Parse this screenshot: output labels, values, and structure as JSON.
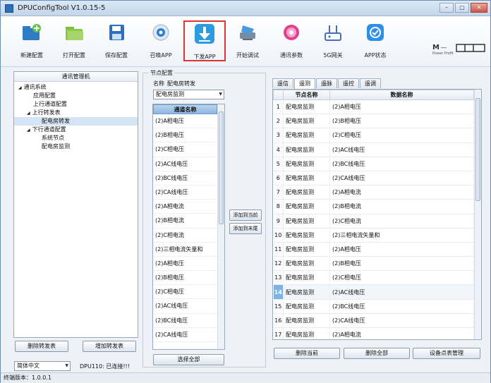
{
  "window": {
    "title": "DPUConfigTool V1.0.15-5",
    "min": "–",
    "max": "▢",
    "close": "✕"
  },
  "toolbar": [
    {
      "label": "新建配置",
      "icon": "new-config-icon"
    },
    {
      "label": "打开配置",
      "icon": "open-folder-icon"
    },
    {
      "label": "保存配置",
      "icon": "save-disk-icon"
    },
    {
      "label": "召唤APP",
      "icon": "summon-app-icon"
    },
    {
      "label": "下发APP",
      "icon": "download-arrow-icon",
      "selected": true
    },
    {
      "label": "开始调试",
      "icon": "debug-icon"
    },
    {
      "label": "通讯参数",
      "icon": "gear-icon"
    },
    {
      "label": "5G网关",
      "icon": "gateway-icon"
    },
    {
      "label": "APP状态",
      "icon": "app-status-icon"
    }
  ],
  "logo": {
    "text": "Power·Profit"
  },
  "tree": {
    "header": "通讯管理机",
    "items": [
      {
        "label": "通讯系统",
        "level": 0,
        "expander": "◢"
      },
      {
        "label": "应用配置",
        "level": 1
      },
      {
        "label": "上行通道配置",
        "level": 1
      },
      {
        "label": "上行转发表",
        "level": 1,
        "expander": "◢"
      },
      {
        "label": "配电房转发",
        "level": 2,
        "selected": true
      },
      {
        "label": "下行通道配置",
        "level": 1,
        "expander": "◢"
      },
      {
        "label": "系统节点",
        "level": 2
      },
      {
        "label": "配电房监测",
        "level": 2
      }
    ]
  },
  "left_buttons": {
    "delete": "删除转发表",
    "add": "增加转发表"
  },
  "language": {
    "value": "简体中文"
  },
  "connection": {
    "text": "DPU110: 已连接!!!"
  },
  "status": {
    "text": "终端版本：1.0.0.1"
  },
  "node_config": {
    "group_title": "节点配置",
    "name_label": "名称",
    "name_value": "配电房转发",
    "device_combo": "配电房监测",
    "list_header": "通道名称",
    "list": [
      "(2)A相电压",
      "(2)B相电压",
      "(2)C相电压",
      "(2)AC线电压",
      "(2)BC线电压",
      "(2)CA线电压",
      "(2)A相电流",
      "(2)B相电流",
      "(2)C相电流",
      "(2)三相电流矢量和",
      "(2)A相电压",
      "(2)B相电压",
      "(2)C相电压",
      "(2)AC线电压",
      "(2)BC线电压",
      "(2)CA线电压"
    ],
    "select_all": "选择全部"
  },
  "mid_buttons": {
    "add_current": "添加到当前",
    "add_end": "添加到末尾"
  },
  "tabs": [
    "遥信",
    "遥测",
    "遥脉",
    "遥控",
    "遥调"
  ],
  "active_tab": 1,
  "table": {
    "columns": [
      "",
      "节点名称",
      "数据名称"
    ],
    "rows": [
      {
        "idx": "1",
        "node": "配电房监测",
        "data": "(2)A相电压"
      },
      {
        "idx": "2",
        "node": "配电房监测",
        "data": "(2)B相电压"
      },
      {
        "idx": "3",
        "node": "配电房监测",
        "data": "(2)C相电压"
      },
      {
        "idx": "4",
        "node": "配电房监测",
        "data": "(2)AC线电压"
      },
      {
        "idx": "5",
        "node": "配电房监测",
        "data": "(2)BC线电压"
      },
      {
        "idx": "6",
        "node": "配电房监测",
        "data": "(2)CA线电压"
      },
      {
        "idx": "7",
        "node": "配电房监测",
        "data": "(2)A相电流"
      },
      {
        "idx": "8",
        "node": "配电房监测",
        "data": "(2)B相电流"
      },
      {
        "idx": "9",
        "node": "配电房监测",
        "data": "(2)C相电流"
      },
      {
        "idx": "10",
        "node": "配电房监测",
        "data": "(2)三相电流矢量和"
      },
      {
        "idx": "11",
        "node": "配电房监测",
        "data": "(2)A相电压"
      },
      {
        "idx": "12",
        "node": "配电房监测",
        "data": "(2)B相电压"
      },
      {
        "idx": "13",
        "node": "配电房监测",
        "data": "(2)C相电压"
      },
      {
        "idx": "14",
        "node": "配电房监测",
        "data": "(2)AC线电压",
        "highlight": true
      },
      {
        "idx": "15",
        "node": "配电房监测",
        "data": "(2)BC线电压"
      },
      {
        "idx": "16",
        "node": "配电房监测",
        "data": "(2)CA线电压"
      },
      {
        "idx": "17",
        "node": "配电房监测",
        "data": "(2)A相电流"
      }
    ]
  },
  "bottom_buttons": {
    "delete_current": "删除当前",
    "delete_all": "删除全部",
    "point_table": "设备点表管理"
  }
}
